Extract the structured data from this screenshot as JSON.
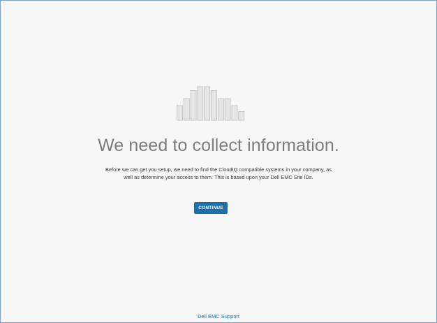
{
  "logo": {
    "icon": "cloudiq-bars-icon",
    "bar_levels": [
      0.42,
      0.62,
      0.85,
      0.96,
      0.96,
      0.85,
      0.62,
      0.62,
      0.42,
      0.25
    ],
    "fill_color": "#e6e6e6",
    "stroke_color": "#bdbdbd"
  },
  "main": {
    "headline": "We need to collect information.",
    "description": "Before we can get you setup, we need to find the CloudIQ compatible systems in your company, as well as determine your access to them. This is based upon your Dell EMC Site IDs.",
    "continue_label": "CONTINUE"
  },
  "footer": {
    "support_link": "Dell EMC Support"
  },
  "colors": {
    "accent": "#1e6fa8",
    "headline": "#7d7d7d",
    "background": "#f7f7f7"
  }
}
